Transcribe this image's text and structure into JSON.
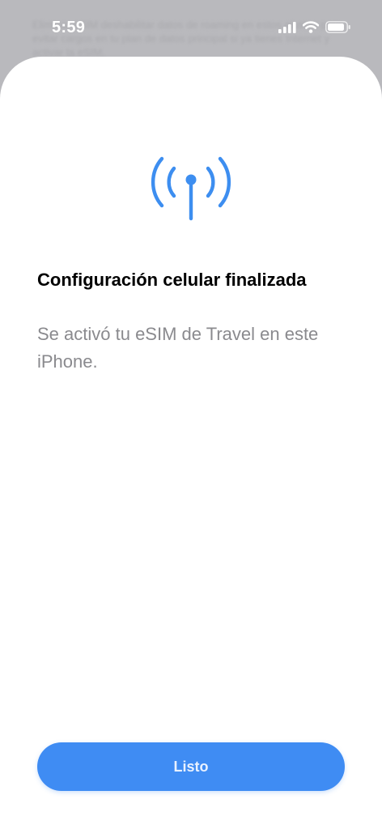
{
  "status_bar": {
    "time": "5:59",
    "icons": [
      "cellular-signal-icon",
      "wifi-icon",
      "battery-icon"
    ]
  },
  "backdrop": {
    "text": "Eliminar eSIM deshabilitar datos de roaming en estos ajustes para evitar cargos en tu plan de datos principal si ya tienes Internet y activar la eSIM."
  },
  "sheet": {
    "hero_icon": "antenna-signal-icon",
    "title": "Configuración celular finalizada",
    "subtitle": "Se activó tu eSIM de Travel en este iPhone.",
    "done_button_label": "Listo"
  },
  "colors": {
    "accent": "#3f8cf3",
    "hero_icon": "#3d8ef0",
    "subtitle": "#8a8a8e"
  }
}
